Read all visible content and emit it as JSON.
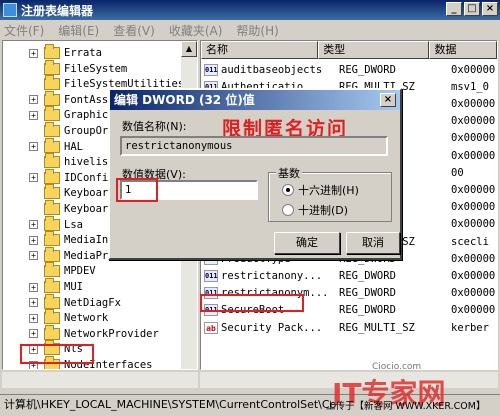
{
  "window": {
    "title": "注册表编辑器",
    "min": "_",
    "max": "□",
    "close": "×"
  },
  "menu": [
    "文件(F)",
    "编辑(E)",
    "查看(V)",
    "收藏夹(A)",
    "帮助(H)"
  ],
  "tree": {
    "items": [
      {
        "label": "Errata",
        "expand": "+"
      },
      {
        "label": "FileSystem",
        "expand": ""
      },
      {
        "label": "FileSystemUtilities",
        "expand": ""
      },
      {
        "label": "FontAsso",
        "expand": "+"
      },
      {
        "label": "Graphics",
        "expand": "+"
      },
      {
        "label": "GroupOrd",
        "expand": ""
      },
      {
        "label": "HAL",
        "expand": "+"
      },
      {
        "label": "hivelist",
        "expand": ""
      },
      {
        "label": "IDConfig",
        "expand": "+"
      },
      {
        "label": "Keyboard",
        "expand": ""
      },
      {
        "label": "Keyboard",
        "expand": ""
      },
      {
        "label": "Lsa",
        "expand": "+"
      },
      {
        "label": "MediaInt",
        "expand": "+"
      },
      {
        "label": "MediaPro",
        "expand": "+"
      },
      {
        "label": "MPDEV",
        "expand": ""
      },
      {
        "label": "MUI",
        "expand": "+"
      },
      {
        "label": "NetDiagFx",
        "expand": "+"
      },
      {
        "label": "Network",
        "expand": "+"
      },
      {
        "label": "NetworkProvider",
        "expand": "+"
      },
      {
        "label": "Nls",
        "expand": "+"
      },
      {
        "label": "NodeInterfaces",
        "expand": "+"
      }
    ]
  },
  "list": {
    "headers": [
      "名称",
      "类型",
      "数据"
    ],
    "rows": [
      {
        "icon": "dword",
        "name": "auditbaseobjects",
        "type": "REG_DWORD",
        "data": "0x00000"
      },
      {
        "icon": "dword",
        "name": "Authenticatio",
        "type": "REG_MULTI_SZ",
        "data": "msv1_0"
      },
      {
        "icon": "dword",
        "name": "",
        "type": "",
        "data": "0x00000 30"
      },
      {
        "icon": "dword",
        "name": "",
        "type": "",
        "data": "0x00000"
      },
      {
        "icon": "dword",
        "name": "",
        "type": "",
        "data": "0x00000"
      },
      {
        "icon": "dword",
        "name": "",
        "type": "",
        "data": "0x00000"
      },
      {
        "icon": "dword",
        "name": "",
        "type": "",
        "data": "00"
      },
      {
        "icon": "dword",
        "name": "",
        "type": "",
        "data": "0x00000"
      },
      {
        "icon": "dword",
        "name": "",
        "type": "",
        "data": "0x00000"
      },
      {
        "icon": "dword",
        "name": "",
        "type": "",
        "data": "0x00000"
      },
      {
        "icon": "sz",
        "name": "Notification ...",
        "type": "REG_MULTI_SZ",
        "data": "scecli"
      },
      {
        "icon": "dword",
        "name": "ProductType",
        "type": "REG_DWORD",
        "data": "0x00000"
      },
      {
        "icon": "dword",
        "name": "restrictanony...",
        "type": "REG_DWORD",
        "data": "0x00000"
      },
      {
        "icon": "dword",
        "name": "restrictanonym...",
        "type": "REG_DWORD",
        "data": "0x00000"
      },
      {
        "icon": "dword",
        "name": "SecureBoot",
        "type": "REG_DWORD",
        "data": "0x00000"
      },
      {
        "icon": "sz",
        "name": "Security Pack...",
        "type": "REG_MULTI_SZ",
        "data": "kerber"
      }
    ]
  },
  "dialog": {
    "title": "编辑 DWORD (32 位)值",
    "name_label": "数值名称(N):",
    "name_value": "restrictanonymous",
    "annotation": "限制匿名访问",
    "data_label": "数值数据(V):",
    "data_value": "1",
    "base_label": "基数",
    "hex_label": "十六进制(H)",
    "dec_label": "十进制(D)",
    "ok": "确定",
    "cancel": "取消",
    "close": "×"
  },
  "status": {
    "text": "计算机\\HKEY_LOCAL_MACHINE\\SYSTEM\\CurrentControlSet\\Co"
  },
  "watermark": {
    "brand": "IT专家网",
    "site": "Ciocio.com",
    "credit": "上传于【新客网 WWW.XKER.COM】"
  },
  "colors": {
    "accent": "#0a246a",
    "annotation_red": "#e02020"
  }
}
